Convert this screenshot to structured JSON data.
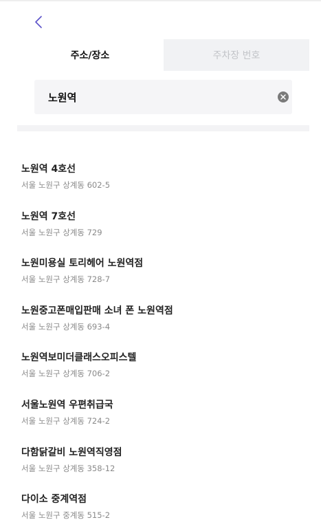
{
  "header": {
    "back_icon": "chevron-left-icon"
  },
  "tabs": [
    {
      "label": "주소/장소",
      "active": true
    },
    {
      "label": "주차장 번호",
      "active": false
    }
  ],
  "search": {
    "value": "노원역",
    "clear_icon": "clear-circle-x-icon"
  },
  "colors": {
    "accent": "#5b52c9",
    "inactive_tab_bg": "#f1f2f4",
    "search_bg": "#f5f5f7"
  },
  "results": [
    {
      "name": "노원역 4호선",
      "address": "서울 노원구 상계동 602-5"
    },
    {
      "name": "노원역 7호선",
      "address": "서울 노원구 상계동 729"
    },
    {
      "name": "노원미용실 토리헤어 노원역점",
      "address": "서울 노원구 상계동 728-7"
    },
    {
      "name": "노원중고폰매입판매 소녀 폰 노원역점",
      "address": "서울 노원구 상계동 693-4"
    },
    {
      "name": "노원역보미더클래스오피스텔",
      "address": "서울 노원구 상계동 706-2"
    },
    {
      "name": "서울노원역 우편취급국",
      "address": "서울 노원구 상계동 724-2"
    },
    {
      "name": "다함닭갈비 노원역직영점",
      "address": "서울 노원구 상계동 358-12"
    },
    {
      "name": "다이소 중계역점",
      "address": "서울 노원구 중계동 515-2"
    }
  ]
}
